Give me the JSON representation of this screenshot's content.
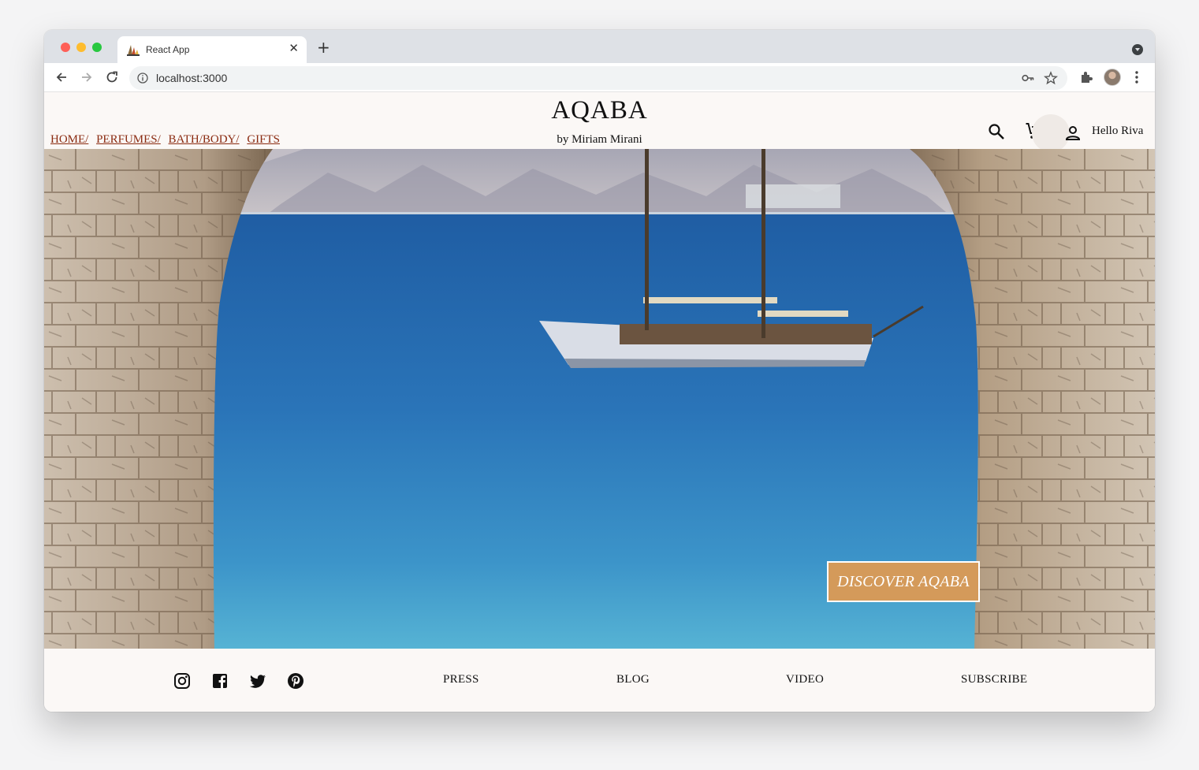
{
  "browser": {
    "tab_title": "React App",
    "tab_close": "✕",
    "new_tab": "+",
    "url": "localhost:3000"
  },
  "header": {
    "brand": "AQABA",
    "byline": "by Miriam Mirani",
    "nav": [
      "HOME/",
      "PERFUMES/",
      "BATH/BODY/",
      "GIFTS"
    ],
    "greeting": "Hello Riva",
    "nav_link_color": "#8a2a10"
  },
  "hero": {
    "cta_label": "DISCOVER AQABA",
    "cta_color": "#d49a5a"
  },
  "footer": {
    "social_icons": [
      "instagram-icon",
      "facebook-icon",
      "twitter-icon",
      "pinterest-icon"
    ],
    "links": [
      "PRESS",
      "BLOG",
      "VIDEO",
      "SUBSCRIBE"
    ]
  }
}
